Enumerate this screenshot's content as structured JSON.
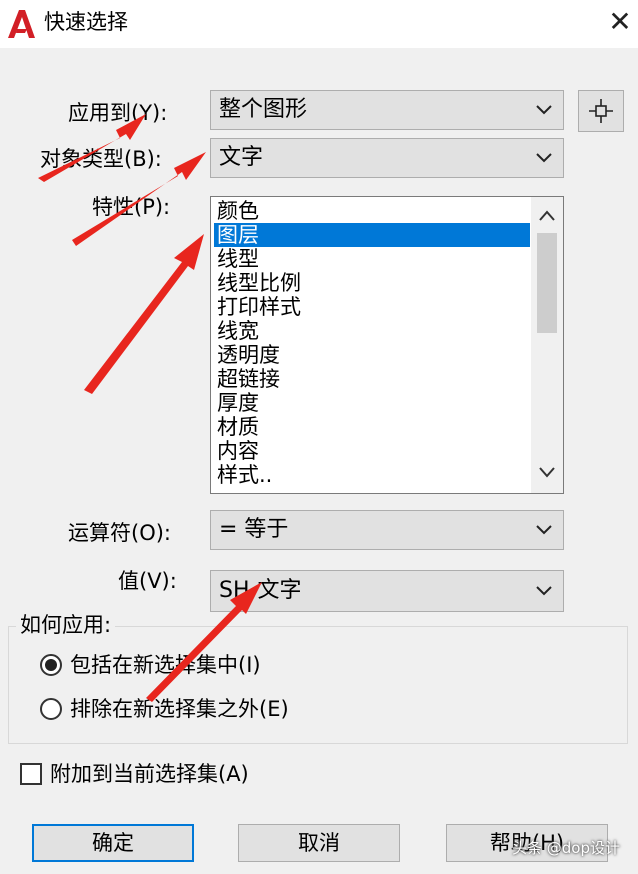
{
  "window": {
    "title": "快速选择",
    "close_icon": "close-icon",
    "app_icon": "autocad-logo-icon",
    "accent_color": "#0078d7",
    "annotation_color": "#e8261e"
  },
  "form": {
    "apply_to": {
      "label": "应用到(Y):",
      "value": "整个图形"
    },
    "object_type": {
      "label": "对象类型(B):",
      "value": "文字"
    },
    "properties": {
      "label": "特性(P):",
      "items": [
        "颜色",
        "图层",
        "线型",
        "线型比例",
        "打印样式",
        "线宽",
        "透明度",
        "超链接",
        "厚度",
        "材质",
        "内容",
        "样式.."
      ],
      "selected": "图层"
    },
    "operator": {
      "label": "运算符(O):",
      "value": "= 等于"
    },
    "value": {
      "label": "值(V):",
      "value": "SH-文字"
    }
  },
  "how_to_apply": {
    "title": "如何应用:",
    "include_label": "包括在新选择集中(I)",
    "exclude_label": "排除在新选择集之外(E)",
    "selected": "include"
  },
  "append": {
    "label": "附加到当前选择集(A)",
    "checked": false
  },
  "buttons": {
    "ok": "确定",
    "cancel": "取消",
    "help": "帮助(H)"
  },
  "watermark": "头条 @dop设计"
}
